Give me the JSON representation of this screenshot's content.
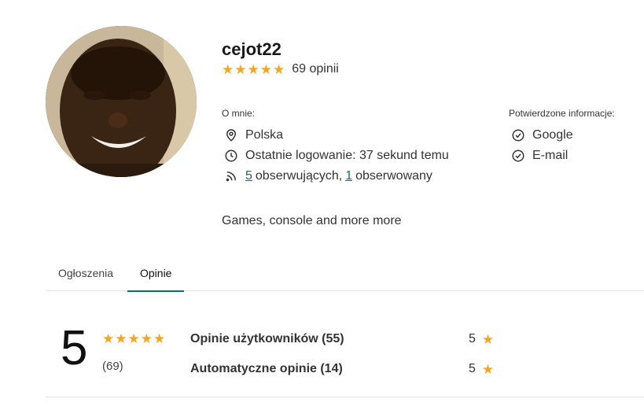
{
  "profile": {
    "username": "cejot22",
    "rating_stars": 5,
    "rating_count_label": "69 opinii",
    "about_label": "O mnie:",
    "location": "Polska",
    "last_login": "Ostatnie logowanie: 37 sekund temu",
    "followers_count": "5",
    "followers_text": "obserwujących,",
    "following_count": "1",
    "following_text": "obserwowany",
    "verified_label": "Potwierdzone informacje:",
    "verified_items": [
      "Google",
      "E-mail"
    ],
    "bio": "Games, console and more more"
  },
  "tabs": [
    {
      "label": "Ogłoszenia",
      "active": false
    },
    {
      "label": "Opinie",
      "active": true
    }
  ],
  "reviews_summary": {
    "score": "5",
    "stars": 5,
    "count_label": "(69)",
    "rows": [
      {
        "label": "Opinie użytkowników (55)",
        "score": "5"
      },
      {
        "label": "Automatyczne opinie (14)",
        "score": "5"
      }
    ]
  },
  "colors": {
    "star": "#f5a524",
    "accent": "#0b6e73"
  },
  "icons": {
    "location": "map-pin-icon",
    "last_login": "clock-icon",
    "followers": "rss-icon",
    "verified": "check-circle-icon",
    "star": "star-icon"
  }
}
